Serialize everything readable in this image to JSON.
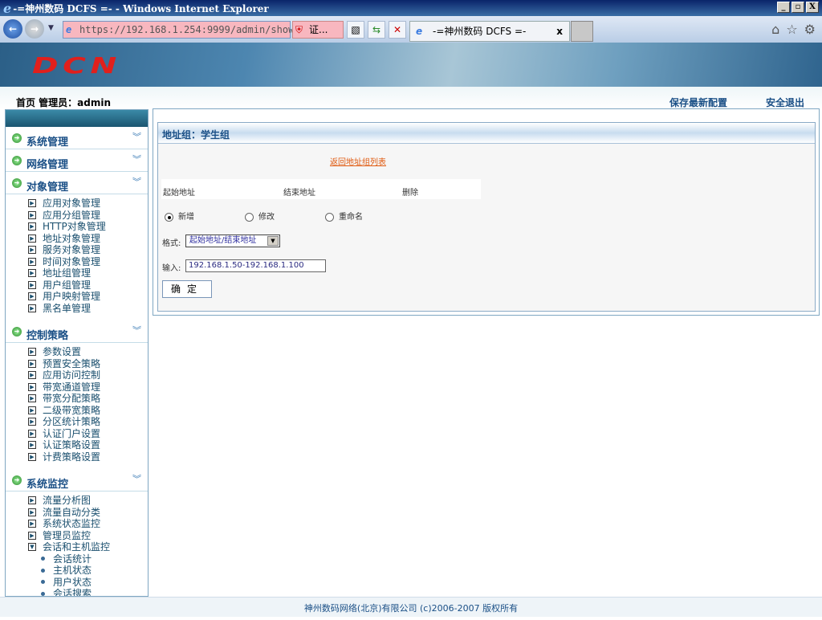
{
  "window": {
    "title": "-=神州数码 DCFS =- - Windows Internet Explorer",
    "controls": [
      "_",
      "▫",
      "X"
    ]
  },
  "browser": {
    "url": "https://192.168.1.254:9999/admin/show/",
    "cert": "证...",
    "tab_title": "-=神州数码 DCFS =-",
    "tab_close": "x"
  },
  "banner": {
    "logo": "DCN"
  },
  "header": {
    "left": "首页 管理员：admin",
    "save": "保存最新配置",
    "logout": "安全退出"
  },
  "sidebar": {
    "sections": [
      {
        "label": "系统管理",
        "items": []
      },
      {
        "label": "网络管理",
        "items": []
      },
      {
        "label": "对象管理",
        "items": [
          "应用对象管理",
          "应用分组管理",
          "HTTP对象管理",
          "地址对象管理",
          "服务对象管理",
          "时间对象管理",
          "地址组管理",
          "用户组管理",
          "用户映射管理",
          "黑名单管理"
        ]
      },
      {
        "label": "控制策略",
        "items": [
          "参数设置",
          "预置安全策略",
          "应用访问控制",
          "带宽通道管理",
          "带宽分配策略",
          "二级带宽策略",
          "分区统计策略",
          "认证门户设置",
          "认证策略设置",
          "计费策略设置"
        ]
      },
      {
        "label": "系统监控",
        "items": [
          "流量分析图",
          "流量自动分类",
          "系统状态监控",
          "管理员监控",
          "会话和主机监控"
        ],
        "expanded_sub": [
          "会话统计",
          "主机状态",
          "用户状态",
          "会话搜索"
        ]
      }
    ]
  },
  "content": {
    "title": "地址组：学生组",
    "back_link": "返回地址组列表",
    "columns": [
      "起始地址",
      "结束地址",
      "删除"
    ],
    "radios": [
      {
        "label": "新增",
        "checked": true
      },
      {
        "label": "修改",
        "checked": false
      },
      {
        "label": "重命名",
        "checked": false
      }
    ],
    "format_label": "格式:",
    "format_value": "起始地址/结束地址",
    "input_label": "输入:",
    "input_value": "192.168.1.50-192.168.1.100",
    "ok": "确定"
  },
  "footer": "神州数码网络(北京)有限公司 (c)2006-2007 版权所有"
}
